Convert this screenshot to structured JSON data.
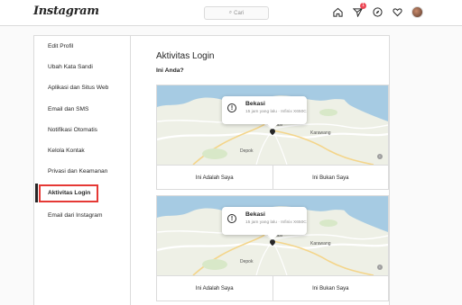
{
  "topbar": {
    "logo": "Instagram",
    "search_placeholder": "Cari",
    "notification_count": "1"
  },
  "sidebar": {
    "items": [
      {
        "label": "Edit Profil"
      },
      {
        "label": "Ubah Kata Sandi"
      },
      {
        "label": "Aplikasi dan Situs Web"
      },
      {
        "label": "Email dan SMS"
      },
      {
        "label": "Notifikasi Otomatis"
      },
      {
        "label": "Kelola Kontak"
      },
      {
        "label": "Privasi dan Keamanan"
      },
      {
        "label": "Aktivitas Login"
      },
      {
        "label": "Email dari Instagram"
      }
    ],
    "active_index": 7
  },
  "main": {
    "title": "Aktivitas Login",
    "question": "Ini Anda?",
    "logins": [
      {
        "city": "Bekasi",
        "meta": "15 jam yang lalu · Infinix X650C",
        "map_labels": {
          "city": "Bekasi",
          "sub": "Depok",
          "east": "Karawang"
        },
        "confirm_label": "Ini Adalah Saya",
        "deny_label": "Ini Bukan Saya"
      },
      {
        "city": "Bekasi",
        "meta": "15 jam yang lalu · Infinix X650C",
        "map_labels": {
          "city": "Bekasi",
          "sub": "Depok",
          "east": "Karawang"
        },
        "confirm_label": "Ini Adalah Saya",
        "deny_label": "Ini Bukan Saya"
      }
    ]
  },
  "colors": {
    "highlight": "#e53935",
    "badge": "#ed4956",
    "water": "#a6cbe3"
  },
  "icons": [
    "search-icon",
    "home-icon",
    "direct-message-icon",
    "explore-icon",
    "heart-icon",
    "info-icon",
    "map-pin-icon"
  ]
}
